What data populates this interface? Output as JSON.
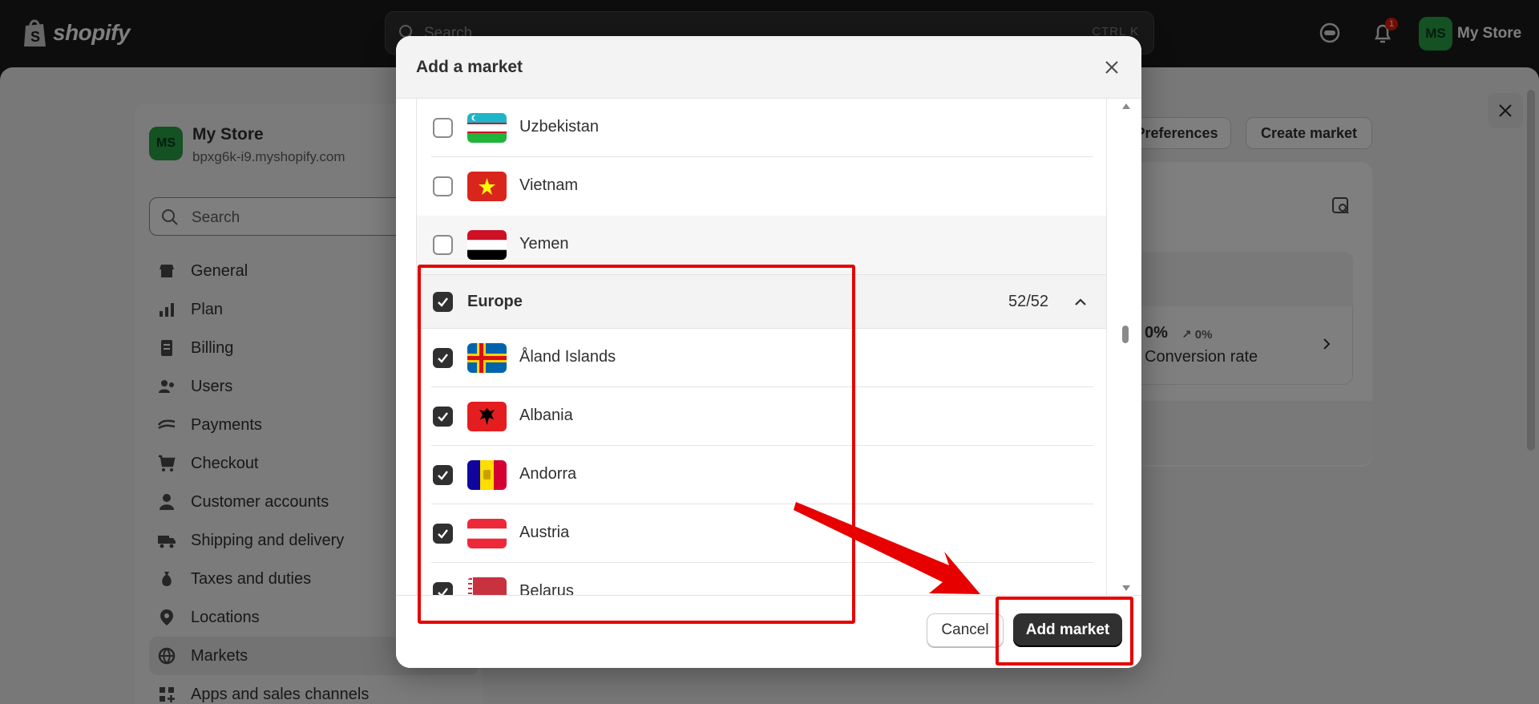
{
  "topbar": {
    "brand": "shopify",
    "search_placeholder": "Search",
    "search_shortcut": "CTRL K",
    "notification_count": "1",
    "avatar_initials": "MS",
    "store_name": "My Store"
  },
  "sidebar": {
    "avatar_initials": "MS",
    "store_name": "My Store",
    "store_domain": "bpxg6k-i9.myshopify.com",
    "search_placeholder": "Search",
    "items": [
      {
        "label": "General",
        "icon": "store-icon"
      },
      {
        "label": "Plan",
        "icon": "plan-icon"
      },
      {
        "label": "Billing",
        "icon": "billing-icon"
      },
      {
        "label": "Users",
        "icon": "users-icon"
      },
      {
        "label": "Payments",
        "icon": "payments-icon"
      },
      {
        "label": "Checkout",
        "icon": "cart-icon"
      },
      {
        "label": "Customer accounts",
        "icon": "person-icon"
      },
      {
        "label": "Shipping and delivery",
        "icon": "truck-icon"
      },
      {
        "label": "Taxes and duties",
        "icon": "tax-icon"
      },
      {
        "label": "Locations",
        "icon": "location-icon"
      },
      {
        "label": "Markets",
        "icon": "globe-icon",
        "active": true
      },
      {
        "label": "Apps and sales channels",
        "icon": "apps-icon"
      }
    ]
  },
  "main": {
    "preferences_label": "Preferences",
    "create_market_label": "Create market",
    "metric_value": "0%",
    "metric_delta": "↗ 0%",
    "metric_label": "Conversion rate"
  },
  "modal": {
    "title": "Add a market",
    "rows_top": [
      {
        "name": "Uzbekistan",
        "checked": false,
        "flag": "uzbekistan-flag-icon"
      },
      {
        "name": "Vietnam",
        "checked": false,
        "flag": "vietnam-flag-icon"
      },
      {
        "name": "Yemen",
        "checked": false,
        "flag": "yemen-flag-icon"
      }
    ],
    "group": {
      "name": "Europe",
      "count": "52/52",
      "checked": true,
      "expanded": true
    },
    "rows_group": [
      {
        "name": "Åland Islands",
        "checked": true,
        "flag": "aland-flag-icon"
      },
      {
        "name": "Albania",
        "checked": true,
        "flag": "albania-flag-icon"
      },
      {
        "name": "Andorra",
        "checked": true,
        "flag": "andorra-flag-icon"
      },
      {
        "name": "Austria",
        "checked": true,
        "flag": "austria-flag-icon"
      },
      {
        "name": "Belarus",
        "checked": true,
        "flag": "belarus-flag-icon"
      }
    ],
    "cancel_label": "Cancel",
    "add_label": "Add market"
  },
  "colors": {
    "annotation": "#e60000",
    "primary_button": "#303030",
    "avatar": "#29a347"
  }
}
